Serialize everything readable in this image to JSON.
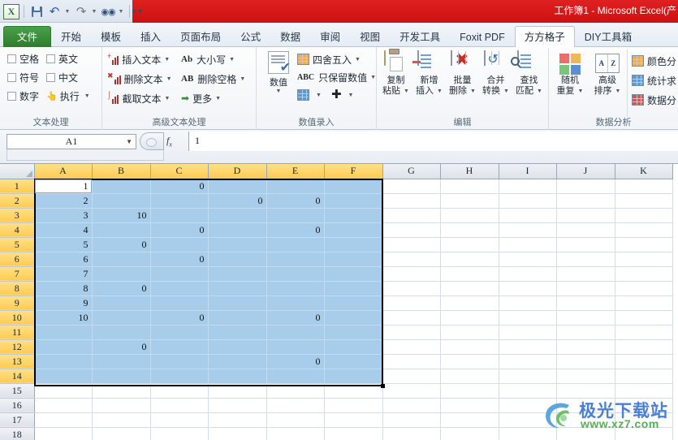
{
  "window": {
    "title": "工作簿1  -  Microsoft Excel(产",
    "quick_access": {
      "app_logo": "X",
      "items": [
        {
          "name": "save-icon",
          "label": "保存"
        },
        {
          "name": "undo-icon",
          "label": "撤销"
        },
        {
          "name": "redo-icon",
          "label": "恢复"
        },
        {
          "name": "find-icon",
          "label": "查找"
        },
        {
          "name": "customize-icon",
          "label": "自定义快速访问工具栏"
        }
      ]
    }
  },
  "tabs": [
    {
      "label": "文件",
      "kind": "file"
    },
    {
      "label": "开始",
      "kind": "normal"
    },
    {
      "label": "模板",
      "kind": "normal"
    },
    {
      "label": "插入",
      "kind": "normal"
    },
    {
      "label": "页面布局",
      "kind": "normal"
    },
    {
      "label": "公式",
      "kind": "normal"
    },
    {
      "label": "数据",
      "kind": "normal"
    },
    {
      "label": "审阅",
      "kind": "normal"
    },
    {
      "label": "视图",
      "kind": "normal"
    },
    {
      "label": "开发工具",
      "kind": "normal"
    },
    {
      "label": "Foxit PDF",
      "kind": "normal"
    },
    {
      "label": "方方格子",
      "kind": "active"
    },
    {
      "label": "DIY工具箱",
      "kind": "normal"
    }
  ],
  "ribbon": {
    "groups": [
      {
        "title": "文本处理",
        "checkboxes": [
          {
            "left": "空格",
            "right": "英文"
          },
          {
            "left": "符号",
            "right": "中文"
          },
          {
            "left": "数字",
            "right": "执行"
          }
        ],
        "run_label": "执行"
      },
      {
        "title": "高级文本处理",
        "col1": [
          {
            "label": "插入文本",
            "icon": "insert-text-icon"
          },
          {
            "label": "删除文本",
            "icon": "delete-text-icon"
          },
          {
            "label": "截取文本",
            "icon": "extract-text-icon"
          }
        ],
        "col2": [
          {
            "label": "大小写",
            "icon": "case-icon",
            "glyph": "Ab"
          },
          {
            "label": "删除空格",
            "icon": "trim-space-icon",
            "glyph": "AB"
          },
          {
            "label": "更多",
            "icon": "more-arrow-icon",
            "glyph": "➡"
          }
        ]
      },
      {
        "title": "数值录入",
        "big_button": {
          "label": "数值",
          "icon": "numeric-doc-icon"
        },
        "items": [
          {
            "label": "四舍五入",
            "icon": "round-icon"
          },
          {
            "label": "只保留数值",
            "icon": "keep-number-only-icon",
            "glyph": "ABC"
          }
        ],
        "small_items": [
          {
            "label": "",
            "icon": "edit-cell-icon"
          },
          {
            "label": "",
            "icon": "plus-icon",
            "glyph": "✚"
          }
        ]
      },
      {
        "title": "编辑",
        "buttons": [
          {
            "line1": "复制",
            "line2": "粘贴",
            "icon": "copy-paste-icon"
          },
          {
            "line1": "新增",
            "line2": "插入",
            "icon": "insert-rows-icon"
          },
          {
            "line1": "批量",
            "line2": "删除",
            "icon": "batch-delete-icon"
          },
          {
            "line1": "合并",
            "line2": "转换",
            "icon": "merge-convert-icon"
          },
          {
            "line1": "查找",
            "line2": "匹配",
            "icon": "find-match-icon"
          }
        ]
      },
      {
        "title": "数据分析",
        "buttons": [
          {
            "line1": "随机",
            "line2": "重复",
            "icon": "random-duplicate-icon"
          },
          {
            "line1": "高级",
            "line2": "排序",
            "icon": "advanced-sort-icon",
            "glyph_a": "A",
            "glyph_z": "Z"
          }
        ],
        "list_items": [
          {
            "label": "颜色分",
            "icon": "color-classify-icon"
          },
          {
            "label": "统计求",
            "icon": "statistics-sum-icon"
          },
          {
            "label": "数据分",
            "icon": "data-analysis-icon"
          }
        ]
      }
    ]
  },
  "formula_bar": {
    "name_box": "A1",
    "fx_label": "fx",
    "formula_value": "1"
  },
  "sheet": {
    "columns": [
      "A",
      "B",
      "C",
      "D",
      "E",
      "F",
      "G",
      "H",
      "I",
      "J",
      "K"
    ],
    "selected_columns": [
      "A",
      "B",
      "C",
      "D",
      "E",
      "F"
    ],
    "rows": [
      1,
      2,
      3,
      4,
      5,
      6,
      7,
      8,
      9,
      10,
      11,
      12,
      13,
      14,
      15,
      16,
      17,
      18
    ],
    "selected_rows": [
      1,
      2,
      3,
      4,
      5,
      6,
      7,
      8,
      9,
      10,
      11,
      12,
      13,
      14
    ],
    "active_cell": "A1",
    "selection_range": "A1:F14",
    "data": [
      {
        "row": 1,
        "A": "1",
        "B": "",
        "C": "0",
        "D": "",
        "E": "",
        "F": ""
      },
      {
        "row": 2,
        "A": "2",
        "B": "",
        "C": "",
        "D": "0",
        "E": "0",
        "F": ""
      },
      {
        "row": 3,
        "A": "3",
        "B": "10",
        "C": "",
        "D": "",
        "E": "",
        "F": ""
      },
      {
        "row": 4,
        "A": "4",
        "B": "",
        "C": "0",
        "D": "",
        "E": "0",
        "F": ""
      },
      {
        "row": 5,
        "A": "5",
        "B": "0",
        "C": "",
        "D": "",
        "E": "",
        "F": ""
      },
      {
        "row": 6,
        "A": "6",
        "B": "",
        "C": "0",
        "D": "",
        "E": "",
        "F": ""
      },
      {
        "row": 7,
        "A": "7",
        "B": "",
        "C": "",
        "D": "",
        "E": "",
        "F": ""
      },
      {
        "row": 8,
        "A": "8",
        "B": "0",
        "C": "",
        "D": "",
        "E": "",
        "F": ""
      },
      {
        "row": 9,
        "A": "9",
        "B": "",
        "C": "",
        "D": "",
        "E": "",
        "F": ""
      },
      {
        "row": 10,
        "A": "10",
        "B": "",
        "C": "0",
        "D": "",
        "E": "0",
        "F": ""
      },
      {
        "row": 11,
        "A": "",
        "B": "",
        "C": "",
        "D": "",
        "E": "",
        "F": ""
      },
      {
        "row": 12,
        "A": "",
        "B": "0",
        "C": "",
        "D": "",
        "E": "",
        "F": ""
      },
      {
        "row": 13,
        "A": "",
        "B": "",
        "C": "",
        "D": "",
        "E": "0",
        "F": ""
      },
      {
        "row": 14,
        "A": "",
        "B": "",
        "C": "",
        "D": "",
        "E": "",
        "F": ""
      },
      {
        "row": 15,
        "A": "",
        "B": "",
        "C": "",
        "D": "",
        "E": "",
        "F": ""
      },
      {
        "row": 16,
        "A": "",
        "B": "",
        "C": "",
        "D": "",
        "E": "",
        "F": ""
      },
      {
        "row": 17,
        "A": "",
        "B": "",
        "C": "",
        "D": "",
        "E": "",
        "F": ""
      },
      {
        "row": 18,
        "A": "",
        "B": "",
        "C": "",
        "D": "",
        "E": "",
        "F": ""
      }
    ]
  },
  "watermark": {
    "brand": "极光下载站",
    "url": "www.xz7.com"
  },
  "colors": {
    "titlebar_red": "#e02020",
    "file_tab_green": "#2d7c2d",
    "selection_fill": "#a8cdea",
    "header_selected": "#ffcb52",
    "watermark_blue": "#4a7fd4",
    "watermark_green": "#5aab5a"
  }
}
